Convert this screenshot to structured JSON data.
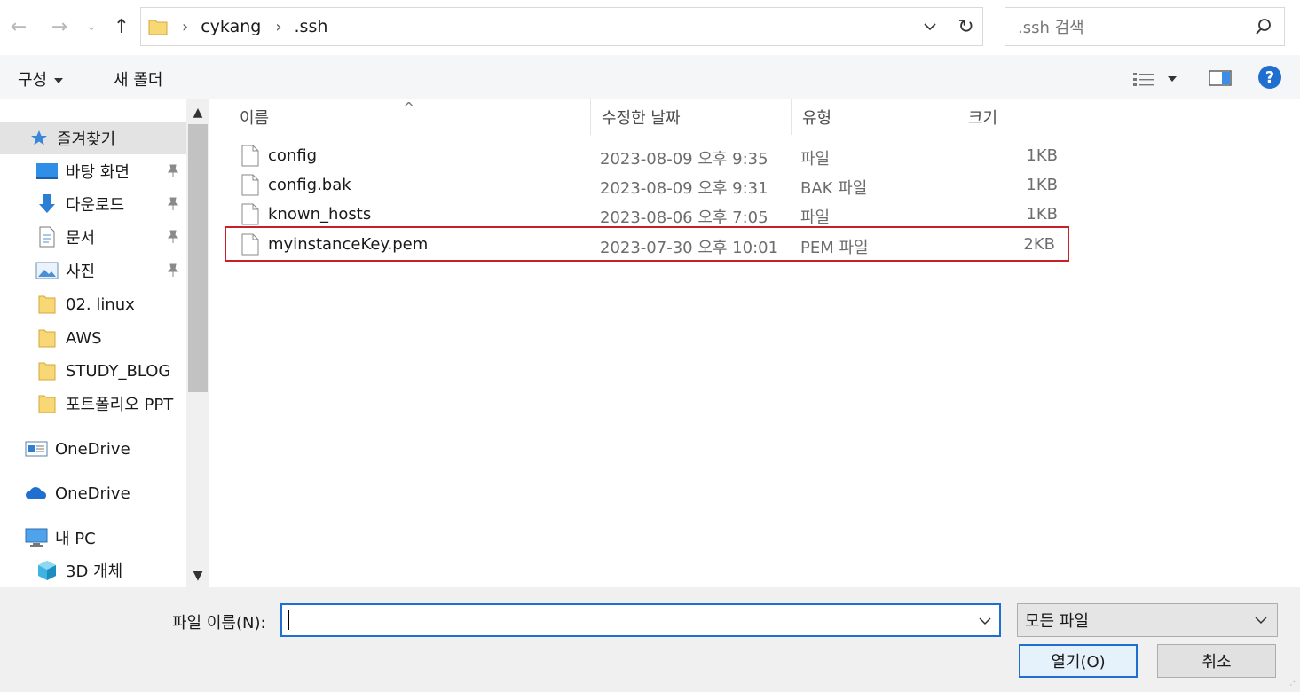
{
  "address": {
    "crumbs": [
      "cykang",
      ".ssh"
    ],
    "search_placeholder": ".ssh 검색"
  },
  "toolbar": {
    "organize_label": "구성",
    "new_folder_label": "새 폴더"
  },
  "sidebar": {
    "items": [
      {
        "label": "즐겨찾기",
        "icon": "star-icon"
      },
      {
        "label": "바탕 화면",
        "icon": "desktop-icon",
        "pinned": true
      },
      {
        "label": "다운로드",
        "icon": "download-icon",
        "pinned": true
      },
      {
        "label": "문서",
        "icon": "document-icon",
        "pinned": true
      },
      {
        "label": "사진",
        "icon": "pictures-icon",
        "pinned": true
      },
      {
        "label": "02. linux",
        "icon": "folder-icon"
      },
      {
        "label": "AWS",
        "icon": "folder-icon"
      },
      {
        "label": "STUDY_BLOG",
        "icon": "folder-icon"
      },
      {
        "label": "포트폴리오 PPT",
        "icon": "folder-icon"
      },
      {
        "label": "OneDrive",
        "icon": "onedrive-app-icon"
      },
      {
        "label": "OneDrive",
        "icon": "onedrive-cloud-icon"
      },
      {
        "label": "내 PC",
        "icon": "pc-icon"
      },
      {
        "label": "3D 개체",
        "icon": "3d-objects-icon"
      }
    ]
  },
  "columns": {
    "name": "이름",
    "modified": "수정한 날짜",
    "type": "유형",
    "size": "크기"
  },
  "files": [
    {
      "name": "config",
      "modified": "2023-08-09 오후 9:35",
      "type": "파일",
      "size": "1KB"
    },
    {
      "name": "config.bak",
      "modified": "2023-08-09 오후 9:31",
      "type": "BAK 파일",
      "size": "1KB"
    },
    {
      "name": "known_hosts",
      "modified": "2023-08-06 오후 7:05",
      "type": "파일",
      "size": "1KB"
    },
    {
      "name": "myinstanceKey.pem",
      "modified": "2023-07-30 오후 10:01",
      "type": "PEM 파일",
      "size": "2KB"
    }
  ],
  "bottom": {
    "filename_label": "파일 이름(N):",
    "filename_value": "",
    "filetype_selected": "모든 파일",
    "open_label": "열기(O)",
    "cancel_label": "취소"
  },
  "colors": {
    "accent": "#1f6fd0",
    "highlight_border": "#c8202a",
    "folder": "#f8d775"
  }
}
